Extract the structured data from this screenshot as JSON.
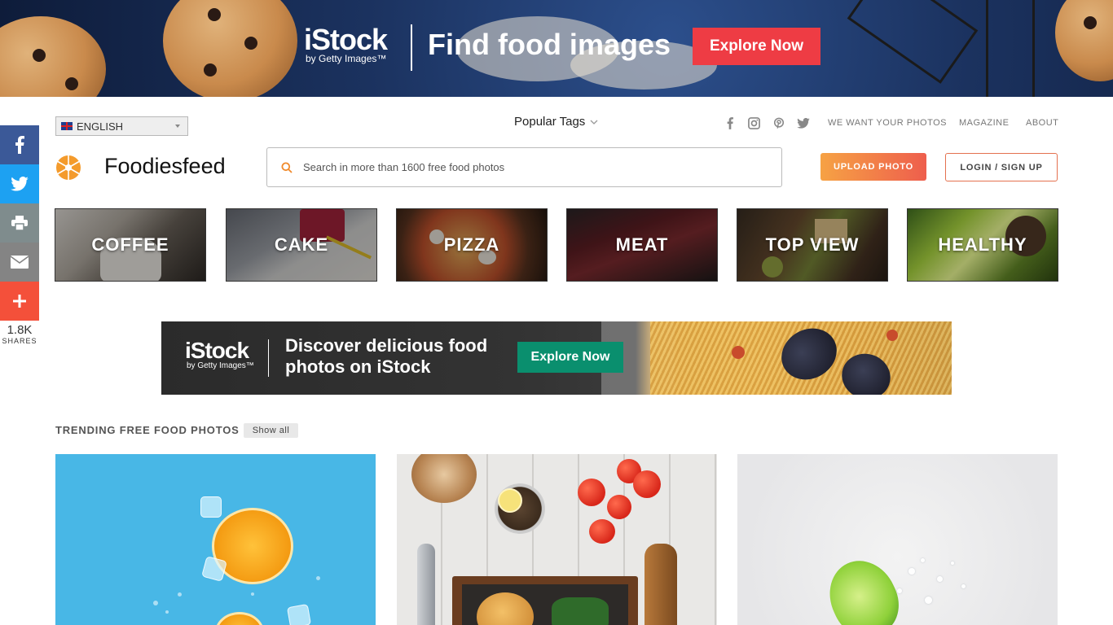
{
  "top_ad": {
    "brand": "iStock",
    "brand_sub": "by Getty Images™",
    "headline": "Find food images",
    "cta": "Explore Now"
  },
  "share": {
    "count": "1.8K",
    "label": "SHARES",
    "buttons": [
      "facebook",
      "twitter",
      "print",
      "email",
      "more"
    ],
    "colors": {
      "facebook": "#3b5998",
      "twitter": "#1da1f2",
      "print": "#7f8c8d",
      "email": "#848484",
      "more": "#f4503a"
    }
  },
  "header": {
    "language": "ENGLISH",
    "popular_tags": "Popular Tags",
    "links": [
      "WE WANT YOUR PHOTOS",
      "MAGAZINE",
      "ABOUT"
    ],
    "social_icons": [
      "facebook-icon",
      "instagram-icon",
      "pinterest-icon",
      "twitter-icon"
    ]
  },
  "brand": {
    "name": "Foodiesfeed"
  },
  "search": {
    "placeholder": "Search in more than 1600 free food photos",
    "value": ""
  },
  "buttons": {
    "upload": "UPLOAD PHOTO",
    "login": "LOGIN / SIGN UP"
  },
  "categories": [
    "COFFEE",
    "CAKE",
    "PIZZA",
    "MEAT",
    "TOP VIEW",
    "HEALTHY"
  ],
  "mid_ad": {
    "brand": "iStock",
    "brand_sub": "by Getty Images™",
    "headline": "Discover delicious food photos on iStock",
    "cta": "Explore Now"
  },
  "trending": {
    "title": "TRENDING FREE FOOD PHOTOS",
    "show_all": "Show all"
  },
  "colors": {
    "accent_orange": "#f6a244",
    "accent_red": "#ee5e4d",
    "istock_red": "#ee3c44",
    "istock_green": "#0a8f6e"
  }
}
